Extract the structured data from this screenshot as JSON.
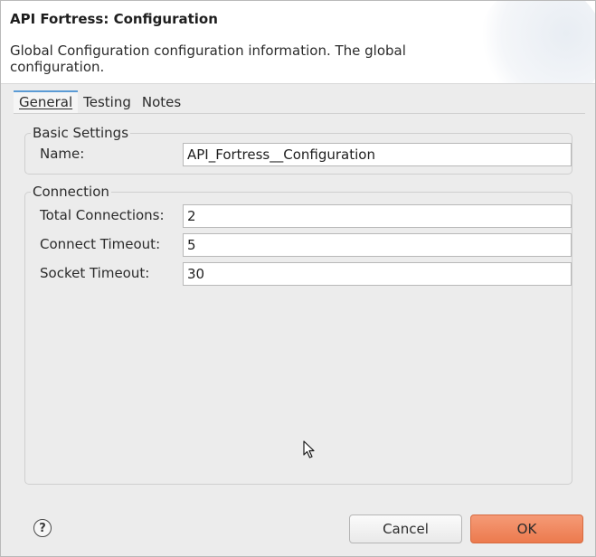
{
  "header": {
    "title": "API Fortress: Configuration",
    "description": "Global Configuration configuration information. The global configuration."
  },
  "tabs": [
    {
      "label": "General",
      "active": true
    },
    {
      "label": "Testing",
      "active": false
    },
    {
      "label": "Notes",
      "active": false
    }
  ],
  "basic_settings": {
    "legend": "Basic Settings",
    "name_label": "Name:",
    "name_value": "API_Fortress__Configuration"
  },
  "connection": {
    "legend": "Connection",
    "total_connections_label": "Total Connections:",
    "total_connections_value": "2",
    "connect_timeout_label": "Connect Timeout:",
    "connect_timeout_value": "5",
    "socket_timeout_label": "Socket Timeout:",
    "socket_timeout_value": "30"
  },
  "footer": {
    "help_glyph": "?",
    "cancel_label": "Cancel",
    "ok_label": "OK"
  },
  "colors": {
    "ok_button": "#ec7a4e",
    "active_tab_accent": "#5b9bd5"
  }
}
